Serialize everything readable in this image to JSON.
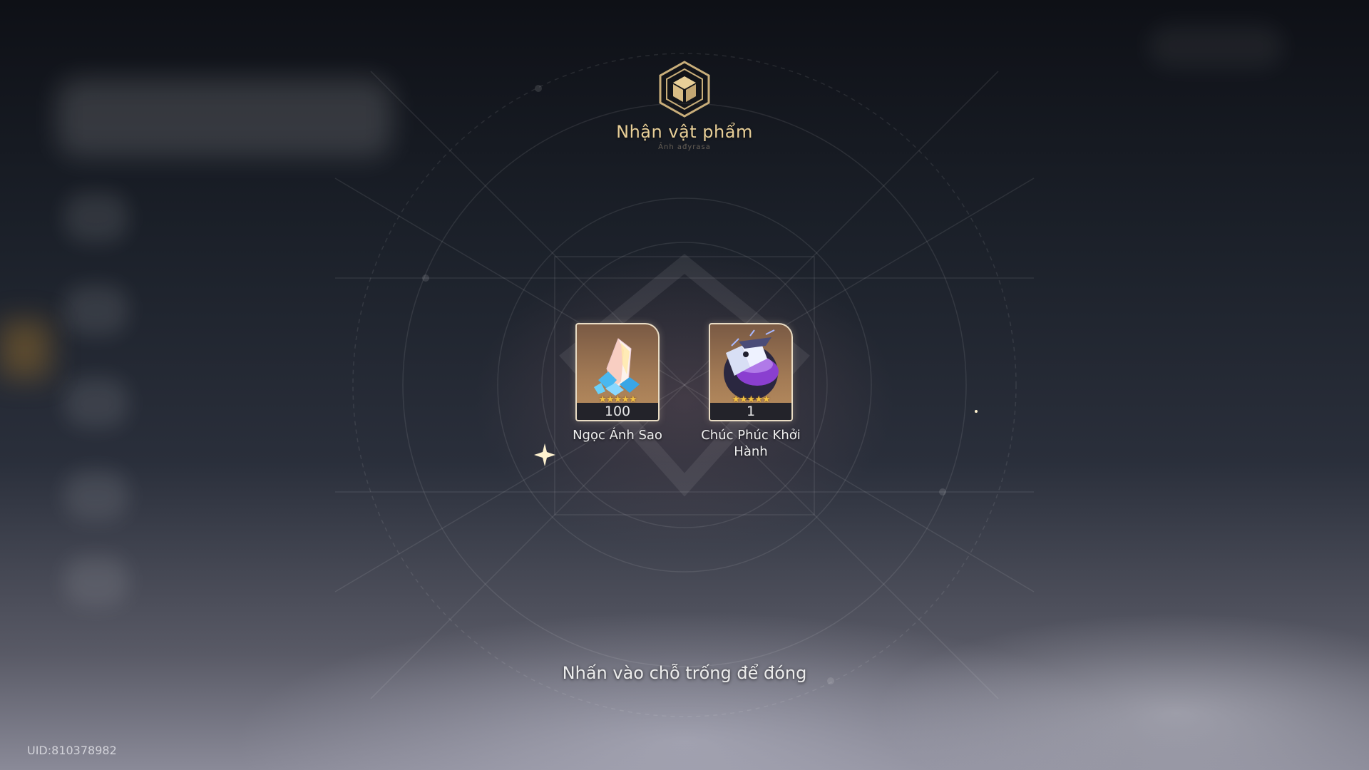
{
  "dialog": {
    "title": "Nhận vật phẩm",
    "subtitle": "Ảnh ađyrasa",
    "icon": "cube-icon"
  },
  "items": [
    {
      "name": "Ngọc Ánh Sao",
      "count": "100",
      "stars": "★★★★★",
      "icon": "crystal-icon"
    },
    {
      "name": "Chúc Phúc Khởi Hành",
      "count": "1",
      "stars": "★★★★★",
      "icon": "blessing-cake-icon"
    }
  ],
  "footer": {
    "close_hint": "Nhấn vào chỗ trống để đóng",
    "uid": "UID:810378982"
  },
  "colors": {
    "title_gold": "#e8cf98",
    "star_gold": "#f2c243",
    "card_frame": "#e9dcc4"
  }
}
